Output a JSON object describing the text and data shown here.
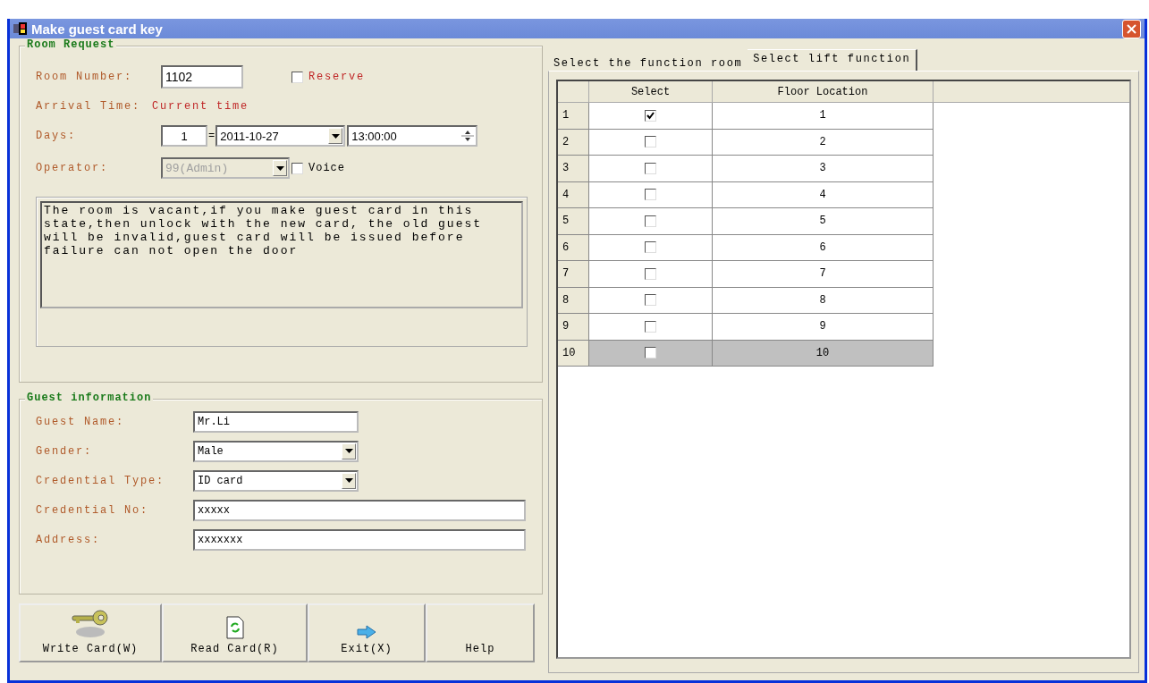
{
  "window": {
    "title": "Make guest card key"
  },
  "room_request": {
    "title": "Room Request",
    "room_number_label": "Room Number:",
    "room_number": "1102",
    "reserve": {
      "label": "Reserve",
      "checked": false
    },
    "arrival_label": "Arrival Time:",
    "arrival_value": "Current time",
    "days_label": "Days:",
    "days": "1",
    "equals": "=",
    "date": "2011-10-27",
    "time": "13:00:00",
    "operator_label": "Operator:",
    "operator": {
      "value": "99(Admin)",
      "disabled": true
    },
    "voice": {
      "label": "Voice",
      "checked": false
    },
    "message": "The room is vacant,if you make guest card in this state,then unlock with the new card, the old guest will be invalid,guest card will be issued before failure can not open the door"
  },
  "guest_information": {
    "title": "Guest information",
    "fields": [
      {
        "kind": "text",
        "label": "Guest Name:",
        "value": "Mr.Li"
      },
      {
        "kind": "dropdown",
        "label": "Gender:",
        "value": "Male"
      },
      {
        "kind": "dropdown",
        "label": "Credential Type:",
        "value": "ID card"
      },
      {
        "kind": "wide",
        "label": "Credential No:",
        "value": "xxxxx"
      },
      {
        "kind": "wide",
        "label": "Address:",
        "value": "xxxxxxx"
      }
    ]
  },
  "buttons": [
    {
      "label": "Write Card(W)",
      "kind": "key"
    },
    {
      "label": "Read Card(R)",
      "kind": "document"
    },
    {
      "label": "Exit(X)",
      "kind": "arrow"
    },
    {
      "label": "Help",
      "kind": "plain"
    }
  ],
  "tabs": [
    {
      "label": "Select the function room",
      "selected": false
    },
    {
      "label": "Select lift function",
      "selected": true
    }
  ],
  "grid": {
    "columns": [
      "Select",
      "Floor Location"
    ],
    "rows": [
      {
        "index": "1",
        "checked": true,
        "floor": "1",
        "selected": false
      },
      {
        "index": "2",
        "checked": false,
        "floor": "2",
        "selected": false
      },
      {
        "index": "3",
        "checked": false,
        "floor": "3",
        "selected": false
      },
      {
        "index": "4",
        "checked": false,
        "floor": "4",
        "selected": false
      },
      {
        "index": "5",
        "checked": false,
        "floor": "5",
        "selected": false
      },
      {
        "index": "6",
        "checked": false,
        "floor": "6",
        "selected": false
      },
      {
        "index": "7",
        "checked": false,
        "floor": "7",
        "selected": false
      },
      {
        "index": "8",
        "checked": false,
        "floor": "8",
        "selected": false
      },
      {
        "index": "9",
        "checked": false,
        "floor": "9",
        "selected": false
      },
      {
        "index": "10",
        "checked": false,
        "floor": "10",
        "selected": true
      }
    ]
  }
}
